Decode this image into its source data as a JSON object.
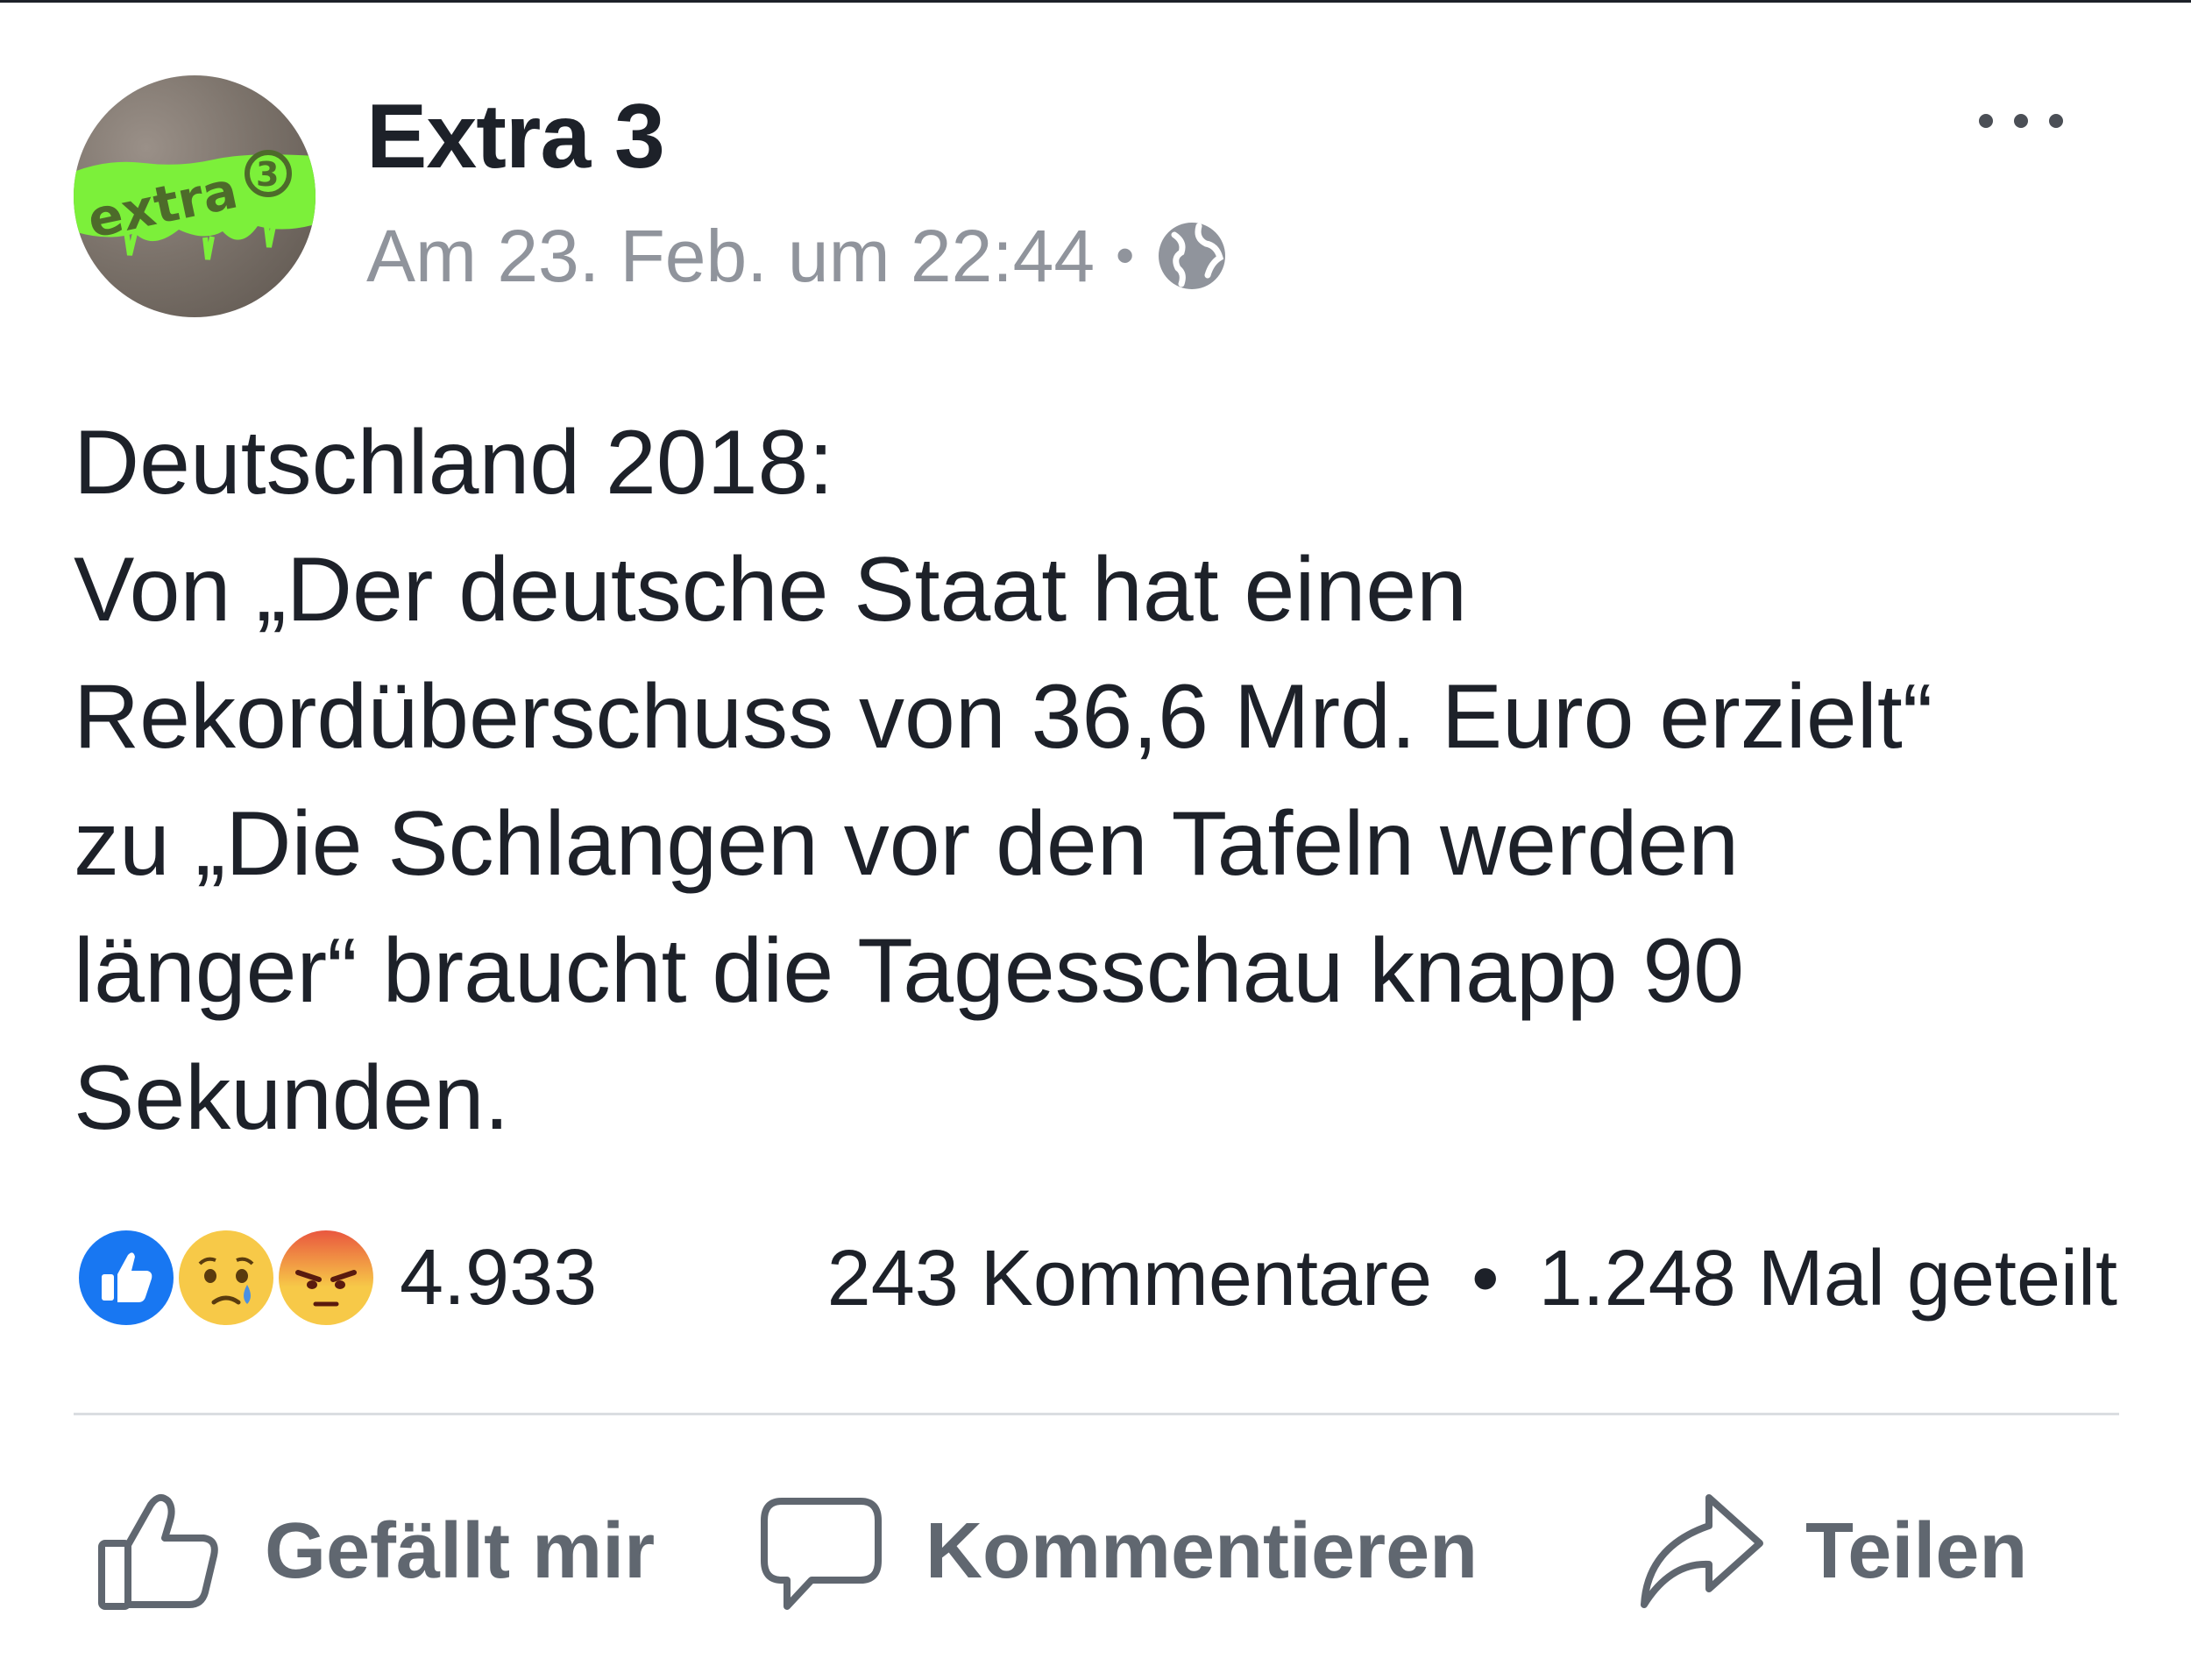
{
  "post": {
    "author": "Extra 3",
    "avatar_text": "extra 3",
    "timestamp": "Am 23. Feb. um 22:44",
    "separator": "•",
    "audience_icon": "globe-icon",
    "more_icon": "more-options-icon",
    "text_lines": [
      "Deutschland 2018:",
      "Von „Der deutsche Staat hat einen",
      "Rekordüberschuss von 36,6 Mrd. Euro erzielt“",
      "zu „Die Schlangen vor den Tafeln werden",
      "länger“ braucht die Tagesschau knapp 90",
      "Sekunden."
    ]
  },
  "reactions": {
    "icons": [
      "like-reaction-icon",
      "sad-reaction-icon",
      "angry-reaction-icon"
    ],
    "count": "4.933"
  },
  "stats": {
    "comments": "243 Kommentare",
    "separator": "•",
    "shares": "1.248 Mal geteilt"
  },
  "actions": {
    "like": "Gefällt mir",
    "comment": "Kommentieren",
    "share": "Teilen"
  },
  "colors": {
    "text": "#1d2129",
    "secondary": "#90949c",
    "action": "#606770",
    "like_blue": "#1877f2",
    "reaction_yellow": "#f7c948",
    "angry_red": "#e9573f",
    "avatar_green": "#7cf03a"
  }
}
